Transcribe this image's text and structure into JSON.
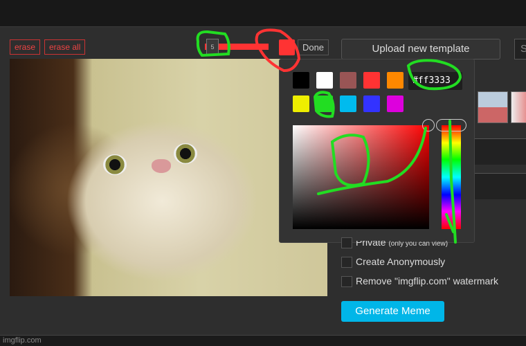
{
  "toolbar": {
    "erase": "erase",
    "erase_all": "erase all",
    "brush_size": "5",
    "done": "Done",
    "current_color": "#ff3333"
  },
  "right": {
    "upload": "Upload new template",
    "search_partial": "S"
  },
  "color_picker": {
    "hex_value": "#ff3333",
    "swatches": [
      "#000000",
      "#ffffff",
      "#995555",
      "#ff3333",
      "#ff8800",
      "#eeee00",
      "#22dd22",
      "#00bbee",
      "#3333ff",
      "#dd00dd"
    ]
  },
  "options": {
    "private_label": "Private",
    "private_note": "(only you can view)",
    "anonymous": "Create Anonymously",
    "watermark": "Remove \"imgflip.com\" watermark"
  },
  "generate": "Generate Meme",
  "footer": "imgflip.com",
  "annotation_color": "#22dd22"
}
